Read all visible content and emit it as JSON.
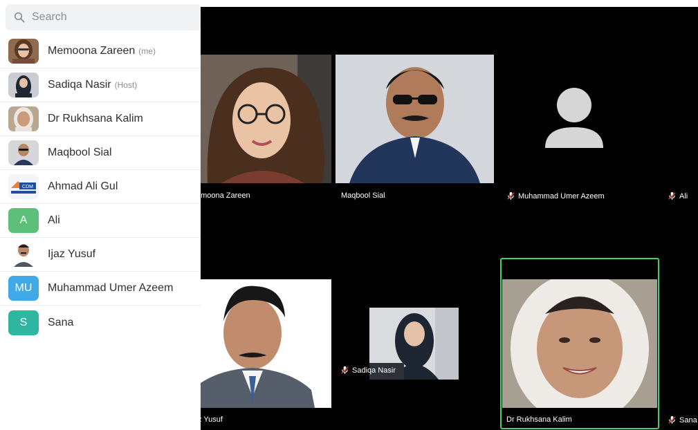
{
  "search": {
    "placeholder": "Search",
    "icon": "search-icon"
  },
  "participants": [
    {
      "name": "Memoona Zareen",
      "tag": "(me)",
      "avatar_type": "photo"
    },
    {
      "name": "Sadiqa Nasir",
      "tag": "(Host)",
      "avatar_type": "photo"
    },
    {
      "name": "Dr Rukhsana Kalim",
      "tag": "",
      "avatar_type": "photo"
    },
    {
      "name": "Maqbool Sial",
      "tag": "",
      "avatar_type": "photo"
    },
    {
      "name": "Ahmad Ali Gul",
      "tag": "",
      "avatar_type": "logo",
      "logo_text": "CDM"
    },
    {
      "name": "Ali",
      "tag": "",
      "avatar_type": "initials",
      "initials": "A",
      "color": "#5cbf7a"
    },
    {
      "name": "Ijaz Yusuf",
      "tag": "",
      "avatar_type": "photo"
    },
    {
      "name": "Muhammad Umer Azeem",
      "tag": "",
      "avatar_type": "initials",
      "initials": "MU",
      "color": "#3fa8e6"
    },
    {
      "name": "Sana",
      "tag": "",
      "avatar_type": "initials",
      "initials": "S",
      "color": "#2fb6a0"
    }
  ],
  "video_tiles": {
    "memoona": {
      "label": "emoona Zareen",
      "muted": false
    },
    "maqbool": {
      "label": "Maqbool Sial",
      "muted": false
    },
    "umer": {
      "label": "Muhammad Umer Azeem",
      "muted": true
    },
    "ali": {
      "label": "Ali",
      "muted": true
    },
    "ijaz": {
      "label": "z Yusuf",
      "muted": false
    },
    "sadiqa": {
      "label": "Sadiqa Nasir",
      "muted": true
    },
    "rukhsana": {
      "label": "Dr Rukhsana Kalim",
      "muted": false,
      "active_speaker": true
    },
    "sana": {
      "label": "Sana",
      "muted": true
    }
  },
  "colors": {
    "active_speaker_border": "#3fd46a",
    "stage_bg": "#000000"
  }
}
